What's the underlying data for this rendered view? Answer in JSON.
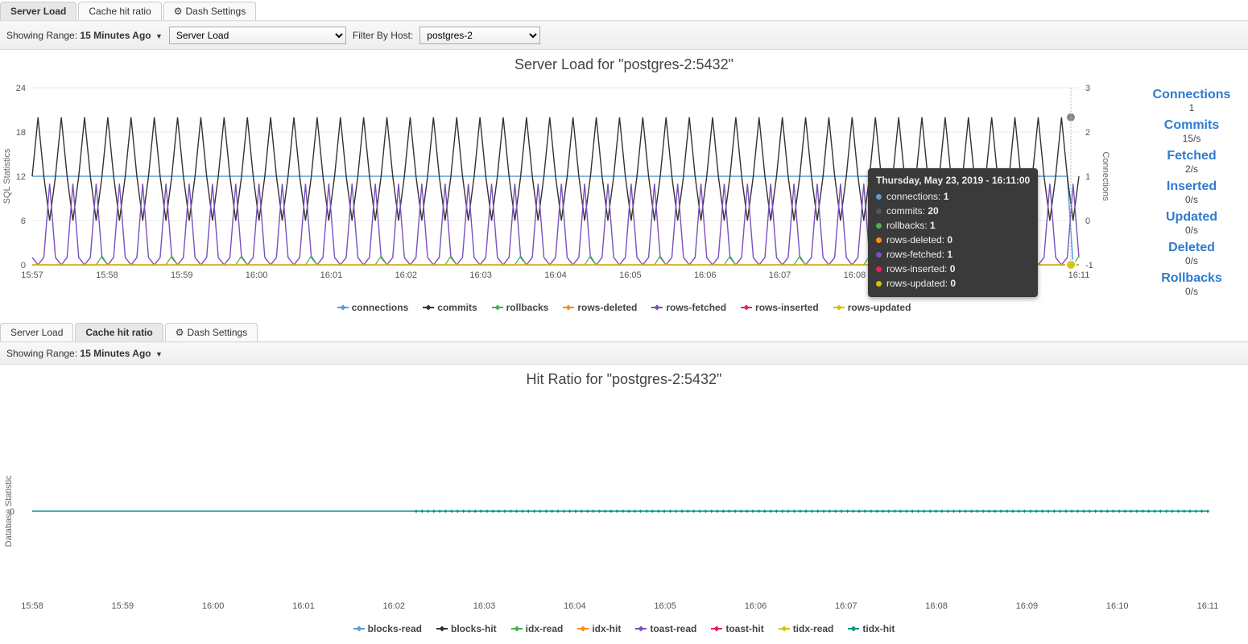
{
  "panel1": {
    "tabs": {
      "0": "Server Load",
      "1": "Cache hit ratio",
      "2": "Dash Settings"
    },
    "range_label": "Showing Range:",
    "range_value": "15 Minutes Ago",
    "metric_select": "Server Load",
    "filter_label": "Filter By Host:",
    "filter_value": "postgres-2",
    "title": "Server Load for \"postgres-2:5432\""
  },
  "panel2": {
    "tabs": {
      "0": "Server Load",
      "1": "Cache hit ratio",
      "2": "Dash Settings"
    },
    "range_label": "Showing Range:",
    "range_value": "15 Minutes Ago",
    "title": "Hit Ratio for \"postgres-2:5432\""
  },
  "stats": {
    "connections": {
      "t": "Connections",
      "v": "1"
    },
    "commits": {
      "t": "Commits",
      "v": "15/s"
    },
    "fetched": {
      "t": "Fetched",
      "v": "2/s"
    },
    "inserted": {
      "t": "Inserted",
      "v": "0/s"
    },
    "updated": {
      "t": "Updated",
      "v": "0/s"
    },
    "deleted": {
      "t": "Deleted",
      "v": "0/s"
    },
    "rollbacks": {
      "t": "Rollbacks",
      "v": "0/s"
    }
  },
  "tooltip": {
    "title": "Thursday, May 23, 2019 - 16:11:00",
    "rows": [
      {
        "k": "connections",
        "v": "1",
        "c": "#5b9bd5"
      },
      {
        "k": "commits",
        "v": "20",
        "c": "#555"
      },
      {
        "k": "rollbacks",
        "v": "1",
        "c": "#4caf50"
      },
      {
        "k": "rows-deleted",
        "v": "0",
        "c": "#ff8c1a"
      },
      {
        "k": "rows-fetched",
        "v": "1",
        "c": "#7b4fbd"
      },
      {
        "k": "rows-inserted",
        "v": "0",
        "c": "#e91e63"
      },
      {
        "k": "rows-updated",
        "v": "0",
        "c": "#d4c300"
      }
    ]
  },
  "legend1": [
    {
      "k": "connections",
      "c": "#5b9bd5"
    },
    {
      "k": "commits",
      "c": "#333"
    },
    {
      "k": "rollbacks",
      "c": "#4caf50"
    },
    {
      "k": "rows-deleted",
      "c": "#ff8c1a"
    },
    {
      "k": "rows-fetched",
      "c": "#7b4fbd"
    },
    {
      "k": "rows-inserted",
      "c": "#e91e63"
    },
    {
      "k": "rows-updated",
      "c": "#d4c300"
    }
  ],
  "legend2": [
    {
      "k": "blocks-read",
      "c": "#5b9bd5"
    },
    {
      "k": "blocks-hit",
      "c": "#333"
    },
    {
      "k": "idx-read",
      "c": "#4caf50"
    },
    {
      "k": "idx-hit",
      "c": "#ff8c1a"
    },
    {
      "k": "toast-read",
      "c": "#7b4fbd"
    },
    {
      "k": "toast-hit",
      "c": "#e91e63"
    },
    {
      "k": "tidx-read",
      "c": "#d4c300"
    },
    {
      "k": "tidx-hit",
      "c": "#009688"
    }
  ],
  "chart_data": [
    {
      "type": "line",
      "title": "Server Load for \"postgres-2:5432\"",
      "x_ticks": [
        "15:57",
        "15:58",
        "15:59",
        "16:00",
        "16:01",
        "16:02",
        "16:03",
        "16:04",
        "16:05",
        "16:06",
        "16:07",
        "16:08",
        "16:09",
        "16:10",
        "16:11"
      ],
      "y_left": {
        "label": "SQL Statistics",
        "ticks": [
          0,
          6,
          12,
          18,
          24
        ]
      },
      "y_right": {
        "label": "Connections",
        "ticks": [
          -1,
          0,
          1,
          2,
          3
        ]
      },
      "note": "commits & rows-fetched oscillate periodically (~3 cycles/min); commits between ~6 and ~20, rows-fetched between ~0 and ~11; connections constant at 1 then drops to -1 at final sample; rollbacks tiny bumps (~1) periodically; rows-inserted/updated/deleted at 0",
      "series": [
        {
          "name": "connections",
          "axis": "right",
          "values_const": 1,
          "final": -1
        },
        {
          "name": "commits",
          "axis": "left",
          "pattern": {
            "low": 6,
            "high": 20,
            "mid": 12,
            "cycles_per_minute": 3
          }
        },
        {
          "name": "rollbacks",
          "axis": "left",
          "pattern": {
            "baseline": 0,
            "spike": 1,
            "cycles_per_minute": 1
          }
        },
        {
          "name": "rows-deleted",
          "axis": "left",
          "values_const": 0
        },
        {
          "name": "rows-fetched",
          "axis": "left",
          "pattern": {
            "low": 0,
            "high": 11,
            "mid": 1,
            "cycles_per_minute": 3
          }
        },
        {
          "name": "rows-inserted",
          "axis": "left",
          "values_const": 0
        },
        {
          "name": "rows-updated",
          "axis": "left",
          "values_const": 0
        }
      ],
      "tooltip_sample": {
        "time": "16:11:00",
        "connections": 1,
        "commits": 20,
        "rollbacks": 1,
        "rows-deleted": 0,
        "rows-fetched": 1,
        "rows-inserted": 0,
        "rows-updated": 0
      }
    },
    {
      "type": "line",
      "title": "Hit Ratio for \"postgres-2:5432\"",
      "x_ticks": [
        "15:58",
        "15:59",
        "16:00",
        "16:01",
        "16:02",
        "16:03",
        "16:04",
        "16:05",
        "16:06",
        "16:07",
        "16:08",
        "16:09",
        "16:10",
        "16:11"
      ],
      "y_left": {
        "label": "Database Statistic",
        "ticks": [
          0
        ]
      },
      "series": [
        {
          "name": "blocks-read",
          "values_const": 0
        },
        {
          "name": "blocks-hit",
          "values_const": 0
        },
        {
          "name": "idx-read",
          "values_const": 0
        },
        {
          "name": "idx-hit",
          "values_const": 0
        },
        {
          "name": "toast-read",
          "values_const": 0
        },
        {
          "name": "toast-hit",
          "values_const": 0
        },
        {
          "name": "tidx-read",
          "values_const": 0
        },
        {
          "name": "tidx-hit",
          "values_const": 0
        }
      ]
    }
  ]
}
